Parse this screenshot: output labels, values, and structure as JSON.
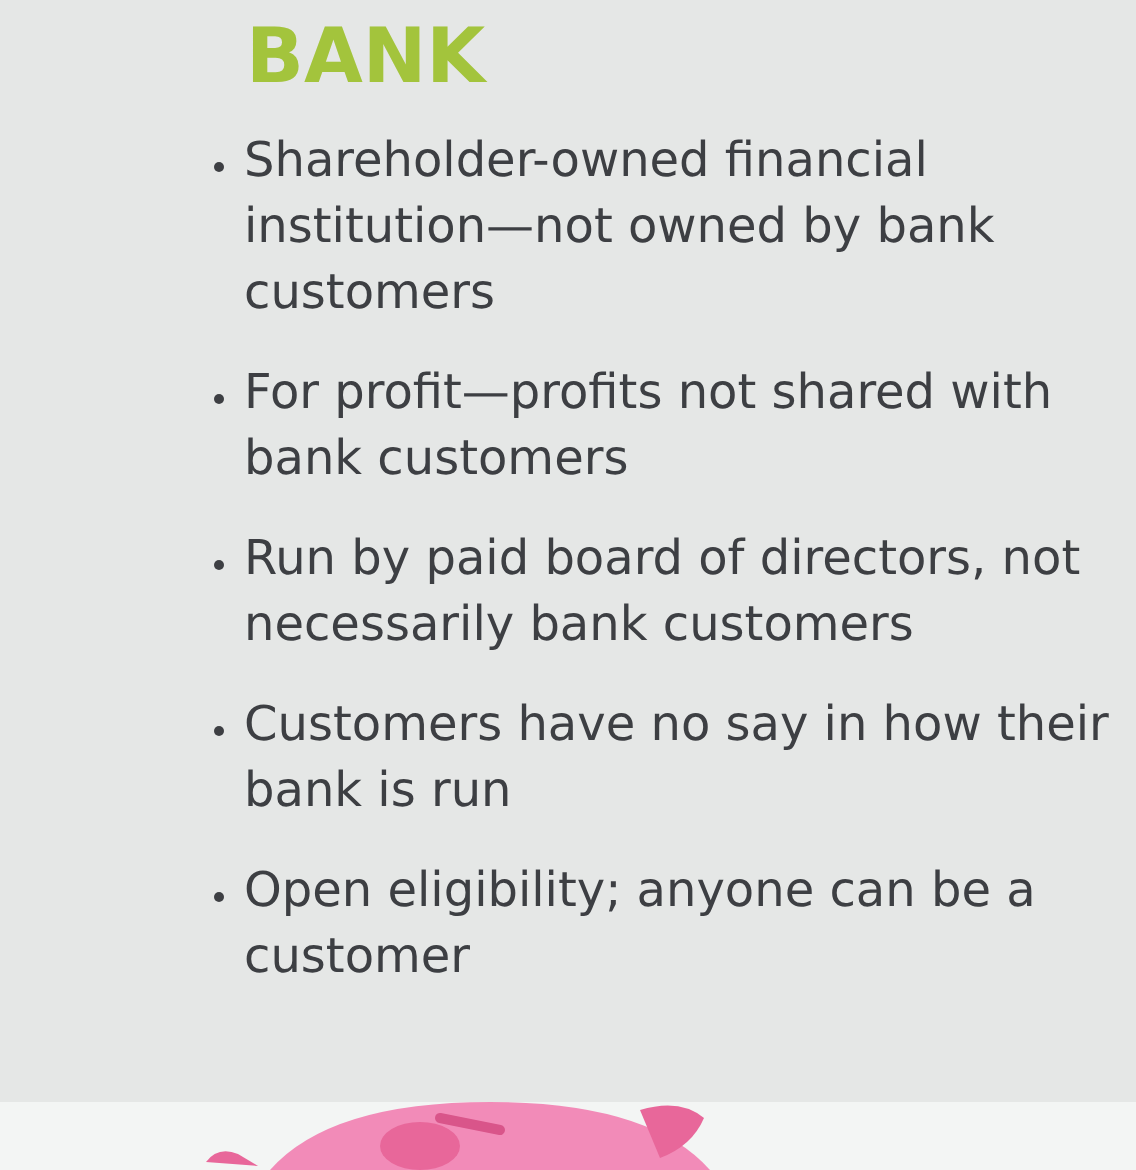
{
  "heading": "BANK",
  "points": [
    "Shareholder-owned financial institution—not owned by bank customers",
    "For profit—profits not shared with bank customers",
    "Run by paid board of directors, not necessarily bank customers",
    "Customers have no say in how their bank is run",
    "Open eligibility; anyone can be a customer"
  ]
}
